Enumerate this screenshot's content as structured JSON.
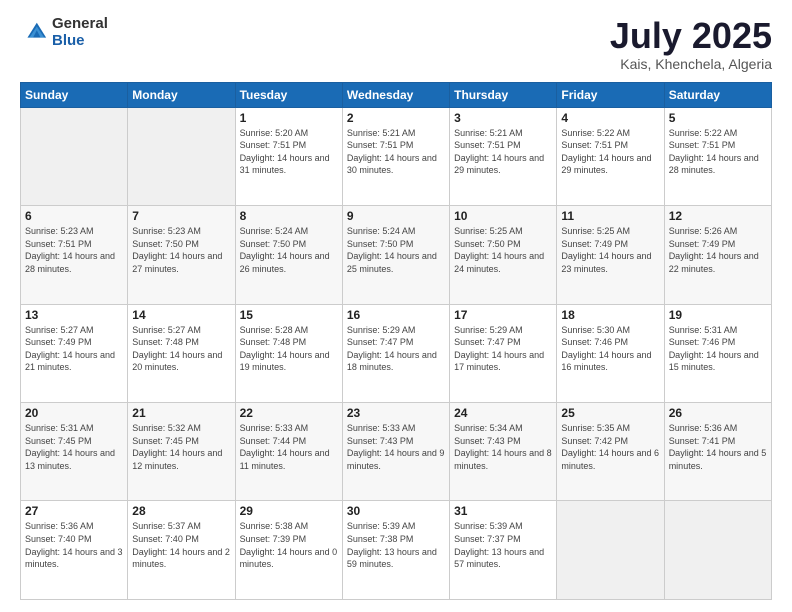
{
  "logo": {
    "general": "General",
    "blue": "Blue"
  },
  "header": {
    "month": "July 2025",
    "location": "Kais, Khenchela, Algeria"
  },
  "weekdays": [
    "Sunday",
    "Monday",
    "Tuesday",
    "Wednesday",
    "Thursday",
    "Friday",
    "Saturday"
  ],
  "weeks": [
    [
      null,
      null,
      {
        "day": 1,
        "sunrise": "5:20 AM",
        "sunset": "7:51 PM",
        "daylight": "14 hours and 31 minutes."
      },
      {
        "day": 2,
        "sunrise": "5:21 AM",
        "sunset": "7:51 PM",
        "daylight": "14 hours and 30 minutes."
      },
      {
        "day": 3,
        "sunrise": "5:21 AM",
        "sunset": "7:51 PM",
        "daylight": "14 hours and 29 minutes."
      },
      {
        "day": 4,
        "sunrise": "5:22 AM",
        "sunset": "7:51 PM",
        "daylight": "14 hours and 29 minutes."
      },
      {
        "day": 5,
        "sunrise": "5:22 AM",
        "sunset": "7:51 PM",
        "daylight": "14 hours and 28 minutes."
      }
    ],
    [
      {
        "day": 6,
        "sunrise": "5:23 AM",
        "sunset": "7:51 PM",
        "daylight": "14 hours and 28 minutes."
      },
      {
        "day": 7,
        "sunrise": "5:23 AM",
        "sunset": "7:50 PM",
        "daylight": "14 hours and 27 minutes."
      },
      {
        "day": 8,
        "sunrise": "5:24 AM",
        "sunset": "7:50 PM",
        "daylight": "14 hours and 26 minutes."
      },
      {
        "day": 9,
        "sunrise": "5:24 AM",
        "sunset": "7:50 PM",
        "daylight": "14 hours and 25 minutes."
      },
      {
        "day": 10,
        "sunrise": "5:25 AM",
        "sunset": "7:50 PM",
        "daylight": "14 hours and 24 minutes."
      },
      {
        "day": 11,
        "sunrise": "5:25 AM",
        "sunset": "7:49 PM",
        "daylight": "14 hours and 23 minutes."
      },
      {
        "day": 12,
        "sunrise": "5:26 AM",
        "sunset": "7:49 PM",
        "daylight": "14 hours and 22 minutes."
      }
    ],
    [
      {
        "day": 13,
        "sunrise": "5:27 AM",
        "sunset": "7:49 PM",
        "daylight": "14 hours and 21 minutes."
      },
      {
        "day": 14,
        "sunrise": "5:27 AM",
        "sunset": "7:48 PM",
        "daylight": "14 hours and 20 minutes."
      },
      {
        "day": 15,
        "sunrise": "5:28 AM",
        "sunset": "7:48 PM",
        "daylight": "14 hours and 19 minutes."
      },
      {
        "day": 16,
        "sunrise": "5:29 AM",
        "sunset": "7:47 PM",
        "daylight": "14 hours and 18 minutes."
      },
      {
        "day": 17,
        "sunrise": "5:29 AM",
        "sunset": "7:47 PM",
        "daylight": "14 hours and 17 minutes."
      },
      {
        "day": 18,
        "sunrise": "5:30 AM",
        "sunset": "7:46 PM",
        "daylight": "14 hours and 16 minutes."
      },
      {
        "day": 19,
        "sunrise": "5:31 AM",
        "sunset": "7:46 PM",
        "daylight": "14 hours and 15 minutes."
      }
    ],
    [
      {
        "day": 20,
        "sunrise": "5:31 AM",
        "sunset": "7:45 PM",
        "daylight": "14 hours and 13 minutes."
      },
      {
        "day": 21,
        "sunrise": "5:32 AM",
        "sunset": "7:45 PM",
        "daylight": "14 hours and 12 minutes."
      },
      {
        "day": 22,
        "sunrise": "5:33 AM",
        "sunset": "7:44 PM",
        "daylight": "14 hours and 11 minutes."
      },
      {
        "day": 23,
        "sunrise": "5:33 AM",
        "sunset": "7:43 PM",
        "daylight": "14 hours and 9 minutes."
      },
      {
        "day": 24,
        "sunrise": "5:34 AM",
        "sunset": "7:43 PM",
        "daylight": "14 hours and 8 minutes."
      },
      {
        "day": 25,
        "sunrise": "5:35 AM",
        "sunset": "7:42 PM",
        "daylight": "14 hours and 6 minutes."
      },
      {
        "day": 26,
        "sunrise": "5:36 AM",
        "sunset": "7:41 PM",
        "daylight": "14 hours and 5 minutes."
      }
    ],
    [
      {
        "day": 27,
        "sunrise": "5:36 AM",
        "sunset": "7:40 PM",
        "daylight": "14 hours and 3 minutes."
      },
      {
        "day": 28,
        "sunrise": "5:37 AM",
        "sunset": "7:40 PM",
        "daylight": "14 hours and 2 minutes."
      },
      {
        "day": 29,
        "sunrise": "5:38 AM",
        "sunset": "7:39 PM",
        "daylight": "14 hours and 0 minutes."
      },
      {
        "day": 30,
        "sunrise": "5:39 AM",
        "sunset": "7:38 PM",
        "daylight": "13 hours and 59 minutes."
      },
      {
        "day": 31,
        "sunrise": "5:39 AM",
        "sunset": "7:37 PM",
        "daylight": "13 hours and 57 minutes."
      },
      null,
      null
    ]
  ]
}
